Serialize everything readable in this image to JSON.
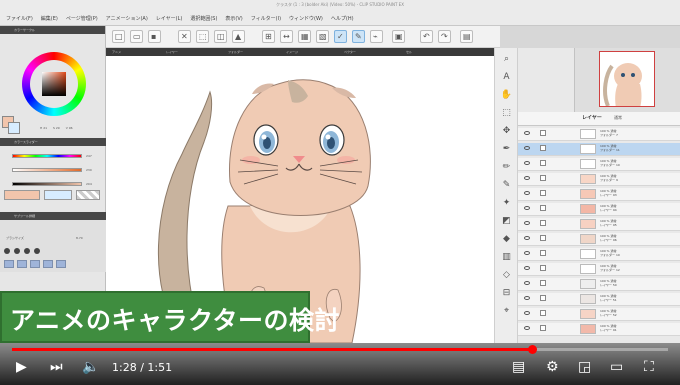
{
  "app": {
    "window_title": "クラスタ (1 : 3 (bolder Aki) (Video: 50%) - CLIP STUDIO PAINT EX",
    "menu": [
      "ファイル(F)",
      "編集(E)",
      "ページ管理(P)",
      "アニメーション(A)",
      "レイヤー(L)",
      "選択範囲(S)",
      "表示(V)",
      "フィルター(I)",
      "ウィンドウ(W)",
      "ヘルプ(H)"
    ]
  },
  "toolbar": {
    "icons": [
      "new-file-icon",
      "open-icon",
      "save-icon",
      "undo-icon",
      "redo-icon",
      "clear-icon",
      "transform-icon",
      "select-icon",
      "pen-icon",
      "brush-icon",
      "cursor-icon",
      "eraser-icon",
      "fill-icon",
      "ruler-icon",
      "visibility-icon",
      "color-icon",
      "move-icon",
      "zoom-icon",
      "rotate-icon",
      "flip-icon"
    ]
  },
  "tabs": {
    "labels": [
      "アニメ",
      "レイヤー",
      "フォルダー",
      "イメージ",
      "ベクター",
      "セル"
    ]
  },
  "color_panel": {
    "title": "カラーサークル",
    "hsv": [
      "H 21",
      "S 29",
      "V 96"
    ],
    "main_color": "#f2c5ac",
    "sub_color": "#d7ecff"
  },
  "slider_panel": {
    "title": "カラースライダー",
    "values": [
      "247",
      "230",
      "204"
    ]
  },
  "sub_tool_panel": {
    "title": "サブツール詳細",
    "size_label": "ブラシサイズ",
    "size_value": "8.70"
  },
  "layer_panel": {
    "title": "レイヤー",
    "blend": "通常",
    "rows": [
      {
        "name": "100 % 通常",
        "sub": "フォルダー 7",
        "selected": false
      },
      {
        "name": "100 % 通常",
        "sub": "フォルダー 11",
        "selected": true
      },
      {
        "name": "100 % 通常",
        "sub": "フォルダー 10",
        "selected": false
      },
      {
        "name": "100 % 通常",
        "sub": "フォルダー 9",
        "selected": false
      },
      {
        "name": "100 % 通常",
        "sub": "レイヤー 93",
        "selected": false
      },
      {
        "name": "100 % 通常",
        "sub": "レイヤー 94",
        "selected": false
      },
      {
        "name": "100 % 通常",
        "sub": "レイヤー 95",
        "selected": false
      },
      {
        "name": "100 % 通常",
        "sub": "レイヤー 96",
        "selected": false
      },
      {
        "name": "100 % 通常",
        "sub": "フォルダー 10",
        "selected": false
      },
      {
        "name": "100 % 通常",
        "sub": "フォルダー 12",
        "selected": false
      },
      {
        "name": "100 % 通常",
        "sub": "レイヤー 50",
        "selected": false
      },
      {
        "name": "100 % 通常",
        "sub": "レイヤー 51",
        "selected": false
      },
      {
        "name": "100 % 通常",
        "sub": "レイヤー 52",
        "selected": false
      },
      {
        "name": "100 % 通常",
        "sub": "レイヤー 91",
        "selected": false
      }
    ]
  },
  "caption": {
    "text": "アニメのキャラクターの検討"
  },
  "player": {
    "current_time": "1:28",
    "duration": "1:51",
    "time_display": "1:28 / 1:51",
    "progress_fraction": 0.793,
    "accent": "#ff0000"
  }
}
